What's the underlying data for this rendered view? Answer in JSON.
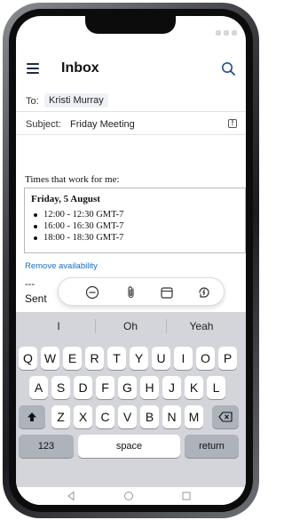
{
  "header": {
    "title": "Inbox"
  },
  "compose": {
    "to_label": "To:",
    "to_value": "Kristi Murray",
    "subject_label": "Subject:",
    "subject_value": "Friday Meeting",
    "intro": "Times that work for me:",
    "availability": {
      "date": "Friday, 5 August",
      "slots": [
        "12:00 - 12:30 GMT-7",
        "16:00 - 16:30 GMT-7",
        "18:00 - 18:30 GMT-7"
      ]
    },
    "remove_link": "Remove availability",
    "separator": "---",
    "signature_prefix": "Sent"
  },
  "keyboard": {
    "suggestions": [
      "I",
      "Oh",
      "Yeah"
    ],
    "row1": [
      "Q",
      "W",
      "E",
      "R",
      "T",
      "Y",
      "U",
      "I",
      "O",
      "P"
    ],
    "row2": [
      "A",
      "S",
      "D",
      "F",
      "G",
      "H",
      "J",
      "K",
      "L"
    ],
    "row3": [
      "Z",
      "X",
      "C",
      "V",
      "B",
      "N",
      "M"
    ],
    "numbers_key": "123",
    "space_key": "space",
    "return_key": "return"
  },
  "icons": {
    "menu": "hamburger-icon",
    "search": "search-icon",
    "importance": "exclamation-icon",
    "toolbar": [
      "minus-circle-icon",
      "paperclip-icon",
      "calendar-icon",
      "lightning-icon"
    ],
    "shift": "shift-arrow-icon",
    "backspace": "backspace-icon",
    "nav": [
      "back-triangle-icon",
      "home-circle-icon",
      "recents-square-icon"
    ]
  },
  "colors": {
    "accent": "#1a6cc8",
    "keyboard_bg": "#d3d5da",
    "title": "#111111"
  }
}
